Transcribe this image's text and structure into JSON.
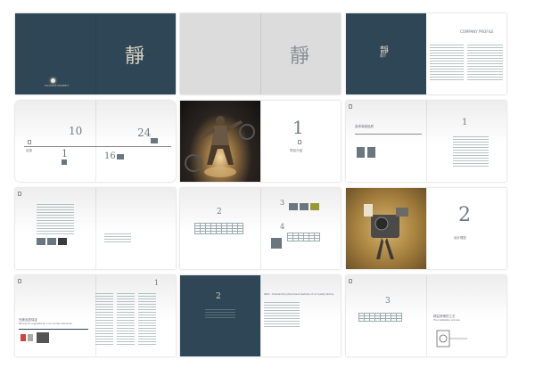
{
  "brochure": {
    "brand_character": "靜",
    "brand_character_small": "靜",
    "cover_tagline": "EXCLUSIVE PROPERTY",
    "profile_title": "COMPANY PROFILE",
    "profile_subtitle": "简介",
    "toc_label": "目录",
    "toc_numbers": [
      "10",
      "24",
      "1",
      "16"
    ],
    "chapter_numbers": [
      "1",
      "2",
      "2",
      "3",
      "4",
      "3",
      "1",
      "2",
      "3"
    ],
    "chapter_captions": [
      "项目介绍",
      "精工品质",
      "设计理念",
      "安装流程"
    ],
    "english_headings": [
      "We pay for engineering in our human resources",
      "Ultra-company human resource",
      "IMAX - Oriented the phenomena features of our quality factory",
      "The installation process"
    ],
    "cn_headings": [
      "追求卓越品质",
      "完美品质保证",
      "精益求精的工艺"
    ]
  },
  "colors": {
    "navy": "#2f4657",
    "gold": "#d9d2bf",
    "grey_page": "#dcdcdc"
  }
}
